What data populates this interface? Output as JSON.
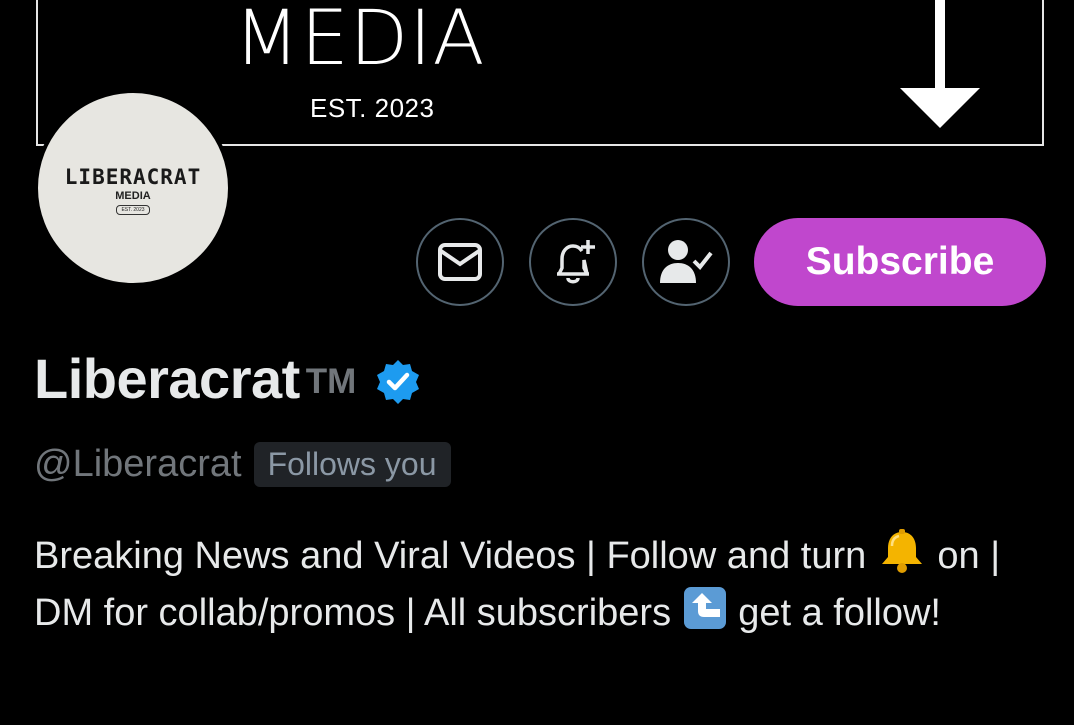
{
  "banner": {
    "title": "MEDIA",
    "est": "EST. 2023",
    "arrow_icon": "arrow-down-icon"
  },
  "avatar": {
    "brand": "LIBERACRAT",
    "sub": "MEDIA",
    "est": "EST. 2023"
  },
  "actions": {
    "message_icon": "envelope-icon",
    "notify_icon": "bell-plus-icon",
    "following_icon": "person-check-icon",
    "subscribe_label": "Subscribe",
    "subscribe_color": "#c047cd"
  },
  "profile": {
    "name": "Liberacrat",
    "tm": "TM",
    "verified_color": "#1d9bf0",
    "handle": "@Liberacrat",
    "follows_you": "Follows you",
    "bio_part1": "Breaking News and Viral Videos | Follow and turn ",
    "bio_part2": " on | DM for collab/promos | All subscribers ",
    "bio_part3": " get a follow!"
  }
}
